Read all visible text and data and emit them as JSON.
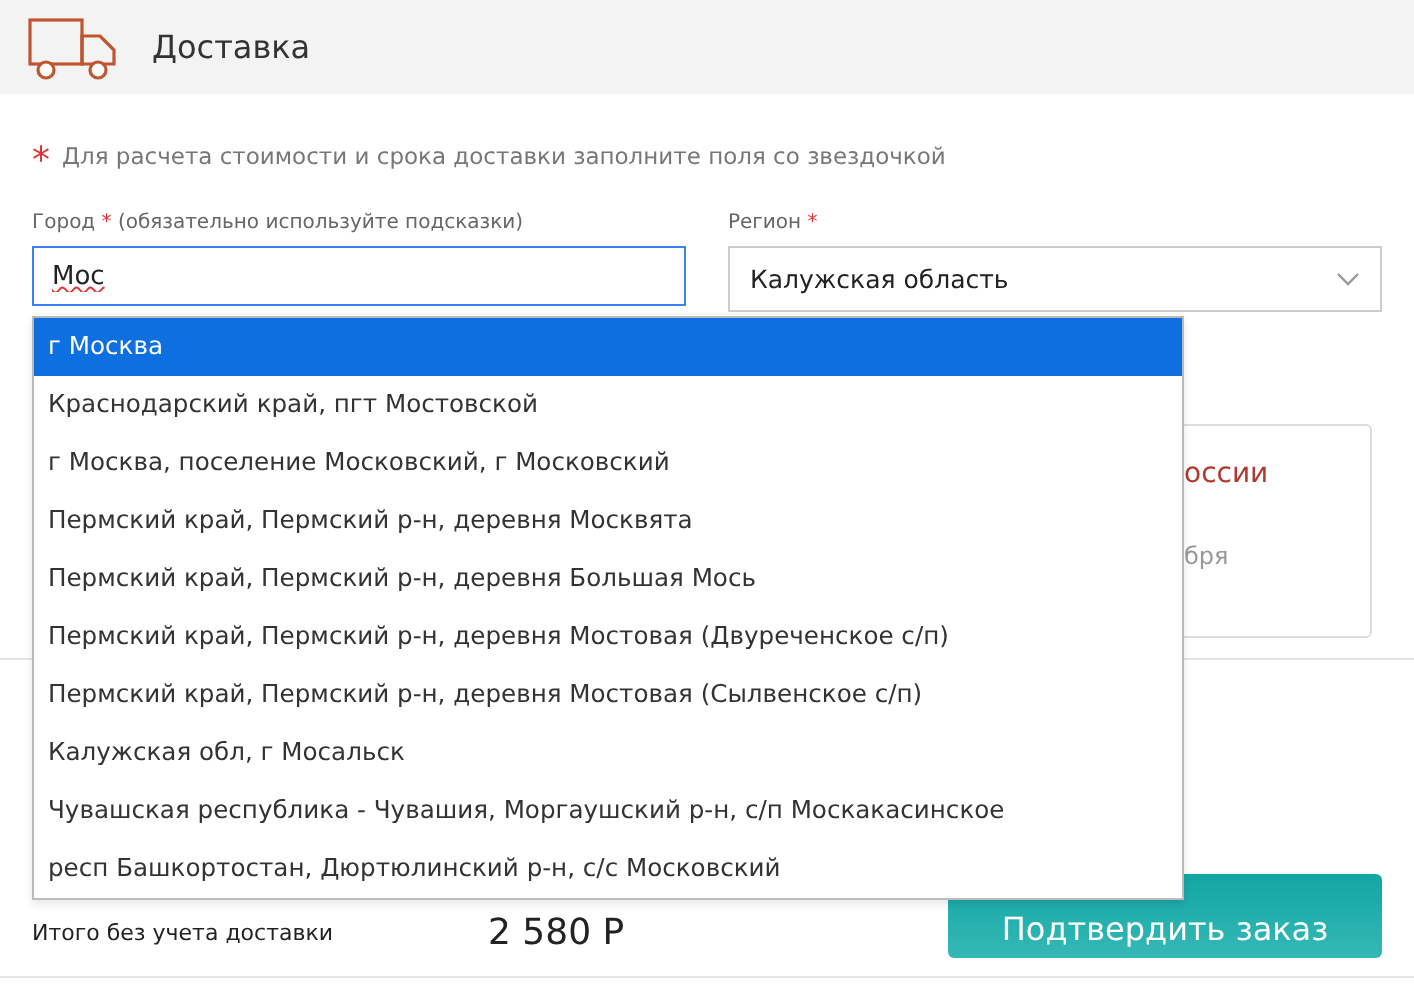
{
  "header": {
    "title": "Доставка"
  },
  "note": {
    "star": "*",
    "text": "Для расчета стоимости и срока доставки заполните поля со звездочкой"
  },
  "city": {
    "label": "Город",
    "star": "*",
    "hint": "(обязательно используйте подсказки)",
    "value": "Мос"
  },
  "region": {
    "label": "Регион",
    "star": "*",
    "value": "Калужская область"
  },
  "suggestions": [
    {
      "text": "г Москва",
      "selected": true
    },
    {
      "text": "Краснодарский край, пгт Мостовской",
      "selected": false
    },
    {
      "text": "г Москва, поселение Московский, г Московский",
      "selected": false
    },
    {
      "text": "Пермский край, Пермский р-н, деревня Москвята",
      "selected": false
    },
    {
      "text": "Пермский край, Пермский р-н, деревня Большая Мось",
      "selected": false
    },
    {
      "text": "Пермский край, Пермский р-н, деревня Мостовая (Двуреченское с/п)",
      "selected": false
    },
    {
      "text": "Пермский край, Пермский р-н, деревня Мостовая (Сылвенское с/п)",
      "selected": false
    },
    {
      "text": "Калужская обл, г Мосальск",
      "selected": false
    },
    {
      "text": "Чувашская республика - Чувашия, Моргаушский р-н, с/п Москакасинское",
      "selected": false
    },
    {
      "text": "респ Башкортостан, Дюртюлинский р-н, с/с Московский",
      "selected": false
    }
  ],
  "delivery_card": {
    "title": "оссии",
    "date": "бря"
  },
  "total": {
    "label": "Итого без учета доставки",
    "amount": "2 580 Р"
  },
  "confirm_button": {
    "label": "Подтвердить заказ"
  }
}
